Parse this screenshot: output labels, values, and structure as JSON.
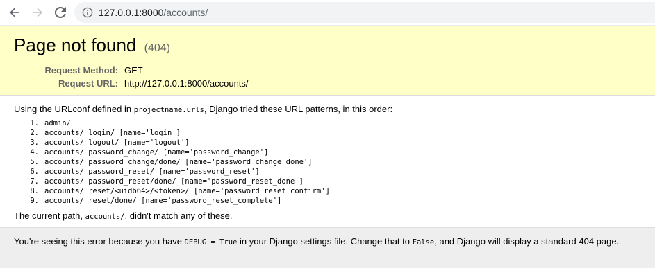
{
  "browser": {
    "icons": {
      "back": "back-arrow-icon",
      "forward": "forward-arrow-icon",
      "reload": "reload-icon",
      "site_info": "info-icon"
    },
    "url_host": "127.0.0.1:8000",
    "url_path": "/accounts/"
  },
  "summary": {
    "title": "Page not found",
    "status_code": "(404)",
    "request_method_label": "Request Method:",
    "request_method_value": "GET",
    "request_url_label": "Request URL:",
    "request_url_value": "http://127.0.0.1:8000/accounts/"
  },
  "info": {
    "intro_before": "Using the URLconf defined in ",
    "intro_code": "projectname.urls",
    "intro_after": ", Django tried these URL patterns, in this order:",
    "patterns": [
      {
        "num": "1.",
        "text": "admin/"
      },
      {
        "num": "2.",
        "text": "accounts/ login/ [name='login']"
      },
      {
        "num": "3.",
        "text": "accounts/ logout/ [name='logout']"
      },
      {
        "num": "4.",
        "text": "accounts/ password_change/ [name='password_change']"
      },
      {
        "num": "5.",
        "text": "accounts/ password_change/done/ [name='password_change_done']"
      },
      {
        "num": "6.",
        "text": "accounts/ password_reset/ [name='password_reset']"
      },
      {
        "num": "7.",
        "text": "accounts/ password_reset/done/ [name='password_reset_done']"
      },
      {
        "num": "8.",
        "text": "accounts/ reset/<uidb64>/<token>/ [name='password_reset_confirm']"
      },
      {
        "num": "9.",
        "text": "accounts/ reset/done/ [name='password_reset_complete']"
      }
    ],
    "current_before": "The current path, ",
    "current_code": "accounts/",
    "current_after": ", didn't match any of these."
  },
  "explanation": {
    "part1": "You're seeing this error because you have ",
    "code1": "DEBUG = True",
    "part2": " in your Django settings file. Change that to ",
    "code2": "False",
    "part3": ", and Django will display a standard 404 page."
  },
  "colors": {
    "summary_bg": "#ffffc8",
    "explanation_bg": "#eeeeee",
    "omnibox_bg": "#f1f3f4"
  }
}
